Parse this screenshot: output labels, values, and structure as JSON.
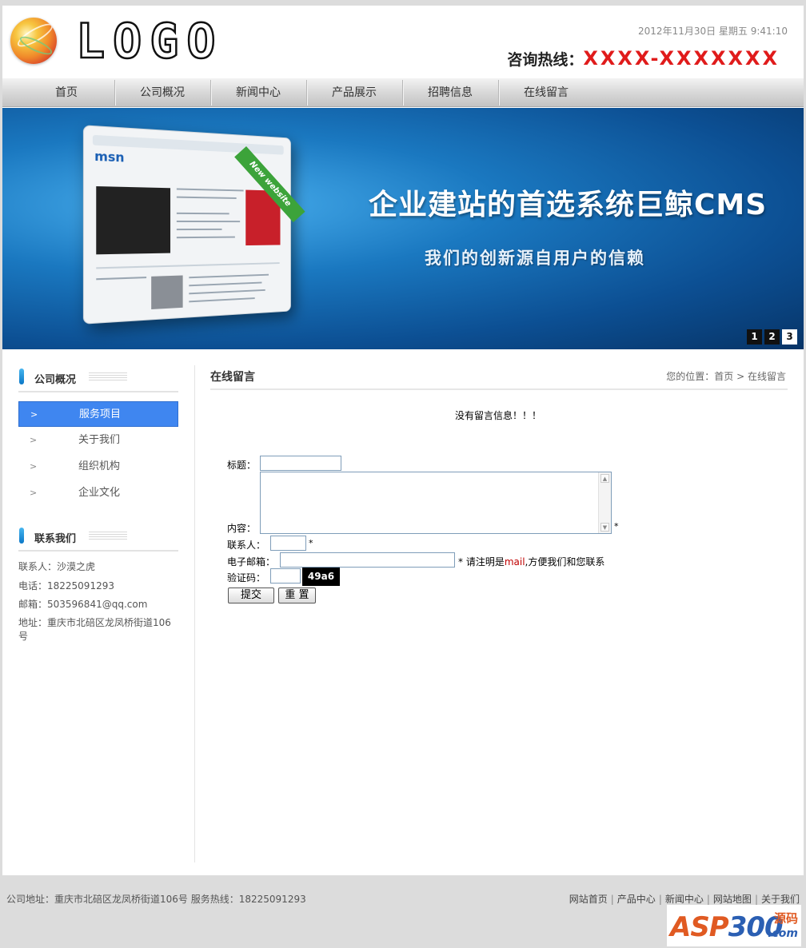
{
  "header": {
    "logo_text": "LOGO",
    "date": "2012年11月30日 星期五 9:41:10",
    "hotline_label": "咨询热线：",
    "hotline_number": "XXXX-XXXXXXX"
  },
  "nav": {
    "items": [
      "首页",
      "公司概况",
      "新闻中心",
      "产品展示",
      "招聘信息",
      "在线留言"
    ]
  },
  "banner": {
    "title": "企业建站的首选系统巨鲸CMS",
    "subtitle": "我们的创新源自用户的信赖",
    "mock_brand": "msn",
    "ribbon": "New website",
    "pages": [
      "1",
      "2",
      "3"
    ],
    "active_page": "3"
  },
  "sidebar": {
    "section1_title": "公司概况",
    "items": [
      "服务项目",
      "关于我们",
      "组织机构",
      "企业文化"
    ],
    "active_item": "服务项目",
    "section2_title": "联系我们",
    "contact": {
      "person": "联系人：沙漠之虎",
      "phone": "电话：18225091293",
      "email": "邮箱：503596841@qq.com",
      "address": "地址：重庆市北碚区龙凤桥街道106号"
    }
  },
  "main": {
    "title": "在线留言",
    "breadcrumb_prefix": "您的位置：",
    "breadcrumb_home": "首页",
    "breadcrumb_sep": ">",
    "breadcrumb_current": "在线留言",
    "no_message": "没有留言信息！！！",
    "form": {
      "title_label": "标题：",
      "title_value": "",
      "content_label": "内容：",
      "content_value": "",
      "contact_label": "联系人：",
      "contact_value": "",
      "email_label": "电子邮箱：",
      "email_value": "",
      "email_hint_pre": "* 请注明是",
      "email_hint_mail": "mail",
      "email_hint_post": ",方便我们和您联系",
      "captcha_label": "验证码：",
      "captcha_value": "",
      "captcha_image_text": "49a6",
      "required_mark": "*",
      "submit_label": "提交",
      "reset_label": "重 置"
    }
  },
  "footer": {
    "address": "公司地址：重庆市北碚区龙凤桥街道106号",
    "service": "服务热线：18225091293",
    "links": [
      "网站首页",
      "产品中心",
      "新闻中心",
      "网站地图",
      "关于我们"
    ],
    "link_sep": "|"
  },
  "watermark": {
    "text_a": "ASP",
    "text_b": "300",
    "text_c": "源码",
    "text_d": ".com"
  },
  "colors": {
    "nav_bg": "#d6d6d6",
    "accent_blue": "#3f86f0",
    "hotline_red": "#e01b1b",
    "banner_blue": "#1a78c0"
  }
}
